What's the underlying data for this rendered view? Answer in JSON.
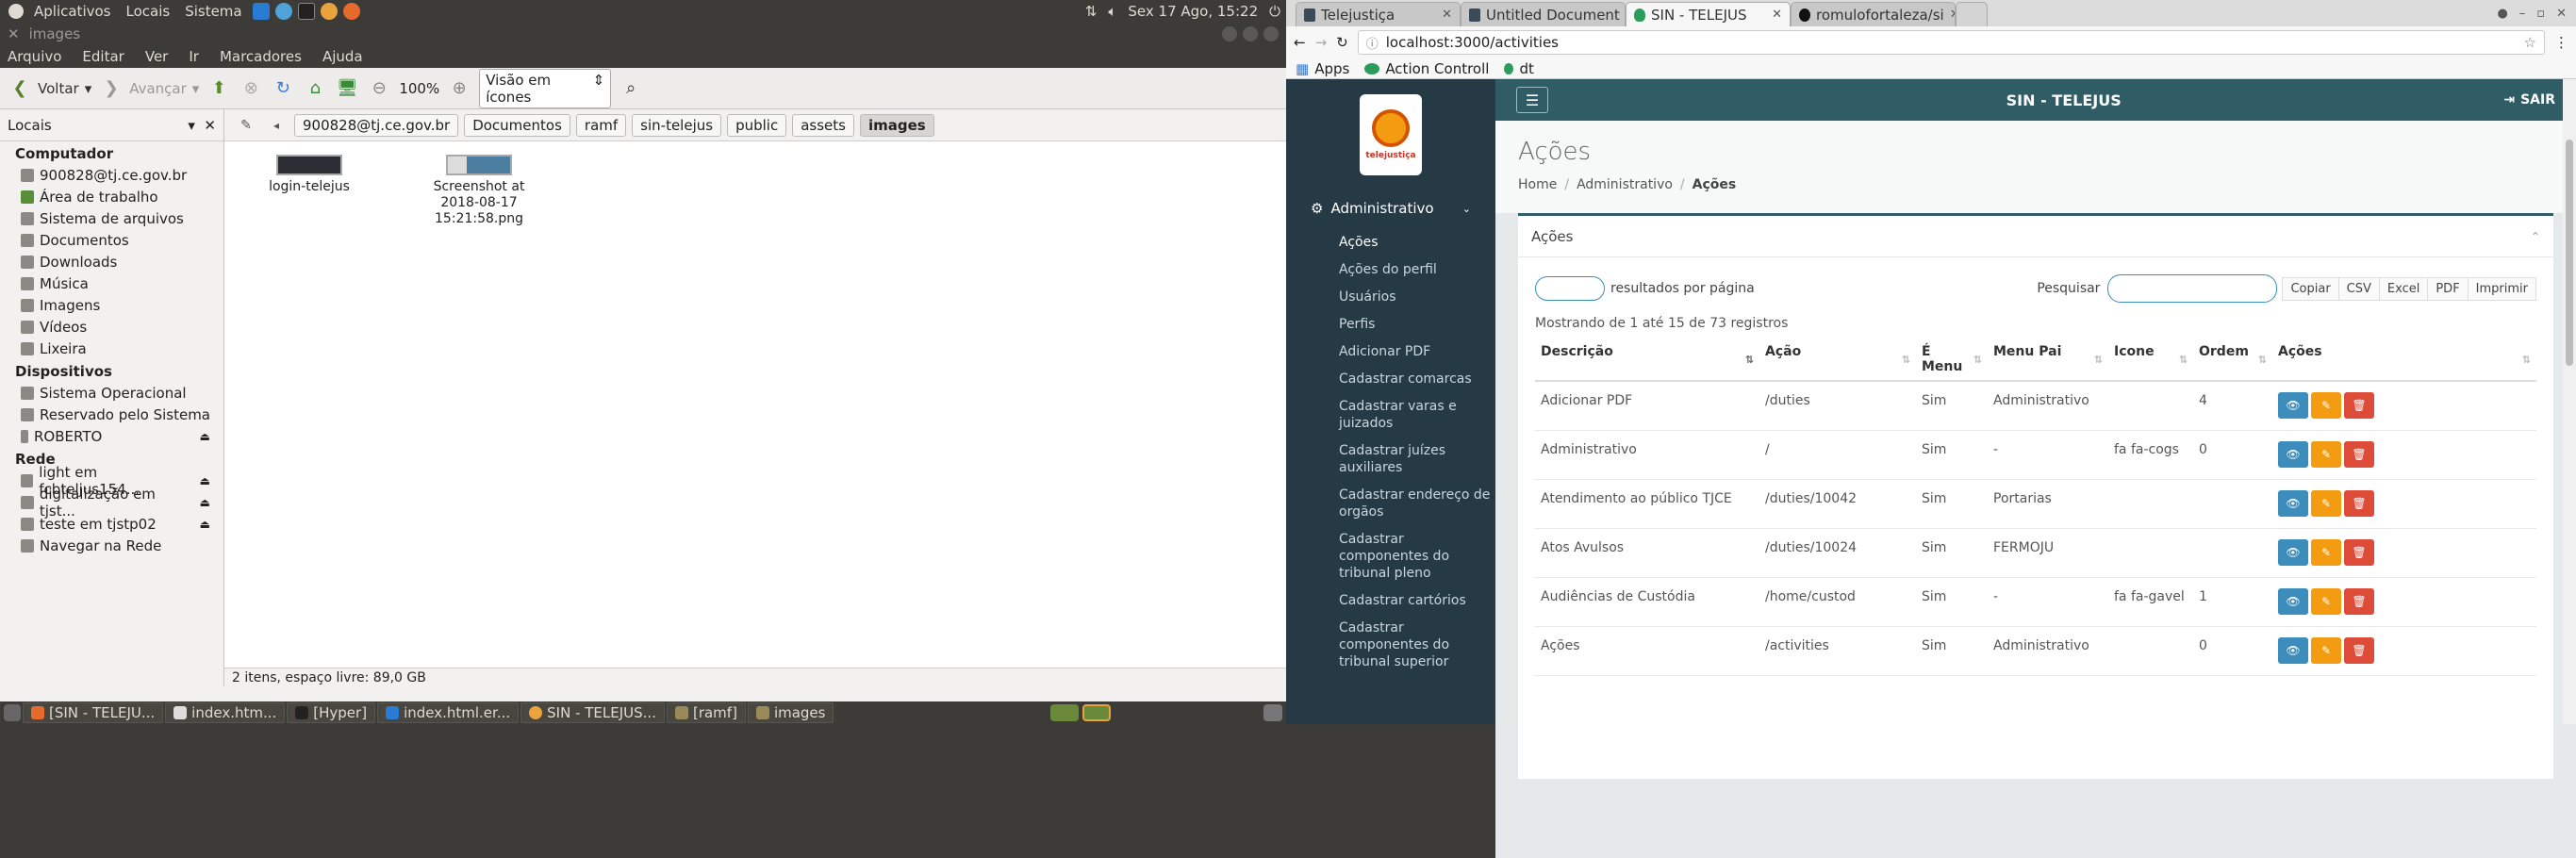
{
  "gnome_panel": {
    "menus": [
      "Aplicativos",
      "Locais",
      "Sistema"
    ],
    "datetime": "Sex 17 Ago, 15:22"
  },
  "nautilus": {
    "window_title": "images",
    "menubar": [
      "Arquivo",
      "Editar",
      "Ver",
      "Ir",
      "Marcadores",
      "Ajuda"
    ],
    "toolbar": {
      "back": "Voltar",
      "forward": "Avançar",
      "zoom": "100%",
      "view_mode": "Visão em ícones"
    },
    "sidebar": {
      "header": "Locais",
      "sections": [
        {
          "title": "Computador",
          "items": [
            "900828@tj.ce.gov.br",
            "Área de trabalho",
            "Sistema de arquivos",
            "Documentos",
            "Downloads",
            "Música",
            "Imagens",
            "Vídeos",
            "Lixeira"
          ]
        },
        {
          "title": "Dispositivos",
          "items": [
            "Sistema Operacional",
            "Reservado pelo Sistema",
            "ROBERTO"
          ]
        },
        {
          "title": "Rede",
          "items": [
            "light em fcbteljus154...",
            "digitalização em tjst...",
            "teste em tjstp02",
            "Navegar na Rede"
          ]
        }
      ]
    },
    "path": [
      "900828@tj.ce.gov.br",
      "Documentos",
      "ramf",
      "sin-telejus",
      "public",
      "assets",
      "images"
    ],
    "files": [
      {
        "name": "login-telejus"
      },
      {
        "name": "Screenshot at 2018-08-17 15:21:58.png"
      }
    ],
    "status": "2 itens, espaço livre: 89,0 GB"
  },
  "taskbar": {
    "tasks": [
      "[SIN - TELEJU...",
      "index.htm...",
      "[Hyper]",
      "index.html.er...",
      "SIN - TELEJUS...",
      "[ramf]",
      "images"
    ]
  },
  "chrome": {
    "tabs": [
      {
        "title": "Telejustiça"
      },
      {
        "title": "Untitled Document"
      },
      {
        "title": "SIN - TELEJUS"
      },
      {
        "title": "romulofortaleza/si"
      }
    ],
    "url": "localhost:3000/activities",
    "bookmarks": [
      "Apps",
      "Action Controll",
      "dt"
    ]
  },
  "app": {
    "brand": "SIN - TELEJUS",
    "logout": "SAIR",
    "logo_text": "telejustiça",
    "sidebar": {
      "group": "Administrativo",
      "items": [
        "Ações",
        "Ações do perfil",
        "Usuários",
        "Perfis",
        "Adicionar PDF",
        "Cadastrar comarcas",
        "Cadastrar varas e juizados",
        "Cadastrar juízes auxiliares",
        "Cadastrar endereço de orgãos",
        "Cadastrar componentes do tribunal pleno",
        "Cadastrar cartórios",
        "Cadastrar componentes do tribunal superior"
      ]
    },
    "page_title": "Ações",
    "breadcrumb": [
      "Home",
      "Administrativo",
      "Ações"
    ],
    "panel_title": "Ações",
    "per_page_label": "resultados por página",
    "search_label": "Pesquisar",
    "export_buttons": [
      "Copiar",
      "CSV",
      "Excel",
      "PDF",
      "Imprimir"
    ],
    "info": "Mostrando de 1 até 15 de 73 registros",
    "columns": [
      "Descrição",
      "Ação",
      "É Menu",
      "Menu Pai",
      "Icone",
      "Ordem",
      "Ações"
    ],
    "rows": [
      [
        "Adicionar PDF",
        "/duties",
        "Sim",
        "Administrativo",
        "",
        "4"
      ],
      [
        "Administrativo",
        "/",
        "Sim",
        "-",
        "fa fa-cogs",
        "0"
      ],
      [
        "Atendimento ao público TJCE",
        "/duties/10042",
        "Sim",
        "Portarias",
        "",
        ""
      ],
      [
        "Atos Avulsos",
        "/duties/10024",
        "Sim",
        "FERMOJU",
        "",
        ""
      ],
      [
        "Audiências de Custódia",
        "/home/custod",
        "Sim",
        "-",
        "fa fa-gavel",
        "1"
      ],
      [
        "Ações",
        "/activities",
        "Sim",
        "Administrativo",
        "",
        "0"
      ]
    ]
  }
}
